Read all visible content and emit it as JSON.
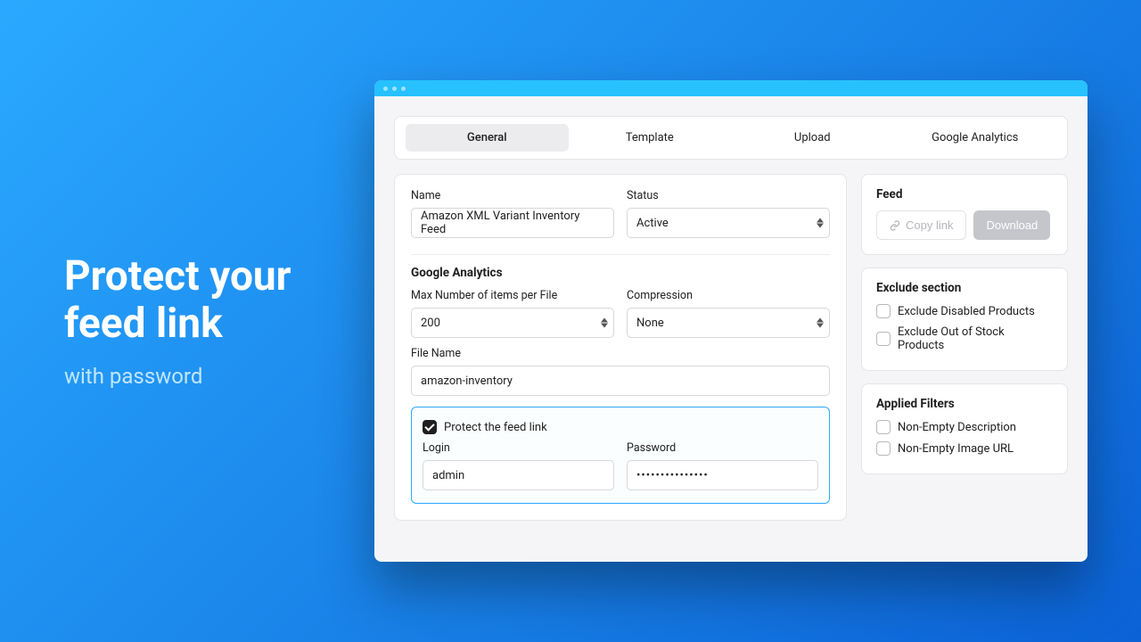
{
  "hero": {
    "title": "Protect your feed link",
    "subtitle": "with password"
  },
  "tabs": {
    "items": [
      "General",
      "Template",
      "Upload",
      "Google Analytics"
    ],
    "active_index": 0
  },
  "form": {
    "name_label": "Name",
    "name_value": "Amazon XML Variant Inventory Feed",
    "status_label": "Status",
    "status_value": "Active",
    "section_title": "Google Analytics",
    "max_items_label": "Max Number of items per File",
    "max_items_value": "200",
    "compression_label": "Compression",
    "compression_value": "None",
    "filename_label": "File Name",
    "filename_value": "amazon-inventory",
    "protect_label": "Protect the feed link",
    "protect_checked": true,
    "login_label": "Login",
    "login_value": "admin",
    "password_label": "Password",
    "password_value": "•••••••••••••••"
  },
  "feed": {
    "title": "Feed",
    "copy_label": "Copy link",
    "download_label": "Download"
  },
  "exclude": {
    "title": "Exclude section",
    "items": [
      {
        "label": "Exclude Disabled Products",
        "checked": false
      },
      {
        "label": "Exclude Out of Stock Products",
        "checked": false
      }
    ]
  },
  "filters": {
    "title": "Applied Filters",
    "items": [
      {
        "label": "Non-Empty Description",
        "checked": false
      },
      {
        "label": "Non-Empty Image URL",
        "checked": false
      }
    ]
  }
}
